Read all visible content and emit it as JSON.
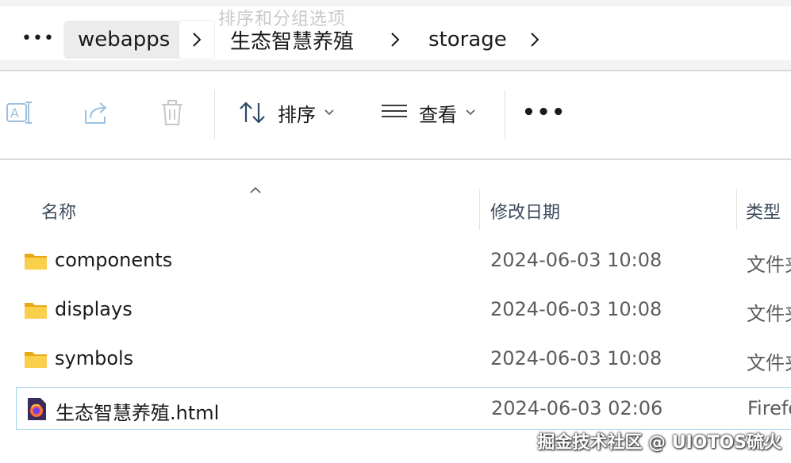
{
  "breadcrumb": {
    "overflow_label": "•••",
    "items": [
      "webapps",
      "生态智慧养殖",
      "storage"
    ]
  },
  "ghost_tooltip": "排序和分组选项",
  "toolbar": {
    "rename_icon": "rename-icon",
    "share_icon": "share-icon",
    "delete_icon": "delete-icon",
    "sort_label": "排序",
    "view_label": "查看",
    "more_label": "•••"
  },
  "columns": {
    "name": "名称",
    "modified": "修改日期",
    "type": "类型"
  },
  "files": [
    {
      "name": "components",
      "modified": "2024-06-03 10:08",
      "type": "文件夹",
      "icon": "folder-icon"
    },
    {
      "name": "displays",
      "modified": "2024-06-03 10:08",
      "type": "文件夹",
      "icon": "folder-icon"
    },
    {
      "name": "symbols",
      "modified": "2024-06-03 10:08",
      "type": "文件夹",
      "icon": "folder-icon"
    },
    {
      "name": "生态智慧养殖.html",
      "modified": "2024-06-03 02:06",
      "type": "Firefox HTML Document",
      "icon": "firefox-html-icon"
    }
  ],
  "watermark": "掘金技术社区 @ UIOTOS硫火",
  "colors": {
    "folder": "#f5c542",
    "selection_border": "#9fd0e8",
    "header_text": "#3d4a5c"
  }
}
